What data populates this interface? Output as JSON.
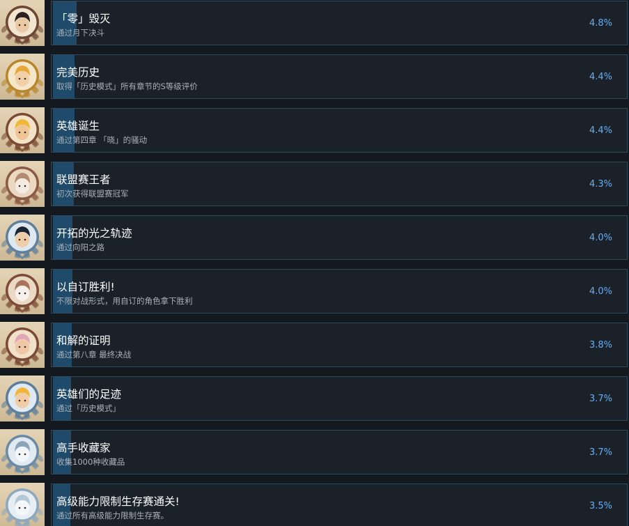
{
  "achievements": [
    {
      "title": "「零」毁灭",
      "desc": "通过月下决斗",
      "pct": "4.8%",
      "progress": 0.048,
      "icon": "two-characters-badge-icon",
      "ring": "#6e4634",
      "face": "#e9c9a6",
      "hair": "#2a2120",
      "bg": "#f1e5cf"
    },
    {
      "title": "完美历史",
      "desc": "取得「历史模式」所有章节的S等级评价",
      "pct": "4.4%",
      "progress": 0.044,
      "icon": "laurel-character-badge-icon",
      "ring": "#b8862a",
      "face": "#f2d0a7",
      "hair": "#e6a83b",
      "bg": "#f4e7c9"
    },
    {
      "title": "英雄诞生",
      "desc": "通过第四章 「晓」的骚动",
      "pct": "4.4%",
      "progress": 0.044,
      "icon": "hero-character-badge-icon",
      "ring": "#7a4b32",
      "face": "#f0c596",
      "hair": "#f1b838",
      "bg": "#f2e3c8"
    },
    {
      "title": "联盟赛王者",
      "desc": "初次获得联盟赛冠军",
      "pct": "4.3%",
      "progress": 0.043,
      "icon": "trophy-badge-icon",
      "ring": "#8b5a44",
      "face": "#f4ece2",
      "hair": "#b48a73",
      "bg": "#ead8c0"
    },
    {
      "title": "开拓的光之轨迹",
      "desc": "通过向阳之路",
      "pct": "4.0%",
      "progress": 0.04,
      "icon": "duo-character-silver-badge-icon",
      "ring": "#5f7f9c",
      "face": "#efcda9",
      "hair": "#1e2431",
      "bg": "#dde8f1"
    },
    {
      "title": "以自订胜利!",
      "desc": "不限对战形式，用自订的角色拿下胜利",
      "pct": "4.0%",
      "progress": 0.04,
      "icon": "custom-wings-badge-icon",
      "ring": "#7d4b37",
      "face": "#f6f1eb",
      "hair": "#a9735d",
      "bg": "#eadac5"
    },
    {
      "title": "和解的证明",
      "desc": "通过第八章 最终决战",
      "pct": "3.8%",
      "progress": 0.038,
      "icon": "reconciliation-badge-icon",
      "ring": "#7b4a34",
      "face": "#efc8a6",
      "hair": "#e0a8b6",
      "bg": "#f1e1c9"
    },
    {
      "title": "英雄们的足迹",
      "desc": "通过「历史模式」",
      "pct": "3.7%",
      "progress": 0.037,
      "icon": "heroes-footprint-badge-icon",
      "ring": "#5c7d9b",
      "face": "#f1cca4",
      "hair": "#f2b63b",
      "bg": "#dfe9f2"
    },
    {
      "title": "高手收藏家",
      "desc": "收集1000种收藏品",
      "pct": "3.7%",
      "progress": 0.037,
      "icon": "collector-badge-icon",
      "ring": "#6a8aa5",
      "face": "#f3f6f9",
      "hair": "#8aa4ba",
      "bg": "#e2eaf1"
    },
    {
      "title": "高级能力限制生存赛通关!",
      "desc": "通过所有高级能力限制生存赛。",
      "pct": "3.5%",
      "progress": 0.035,
      "icon": "survival-crest-badge-icon",
      "ring": "#8ea7bc",
      "face": "#f5f8fb",
      "hair": "#b5c6d4",
      "bg": "#e6edf3"
    }
  ]
}
